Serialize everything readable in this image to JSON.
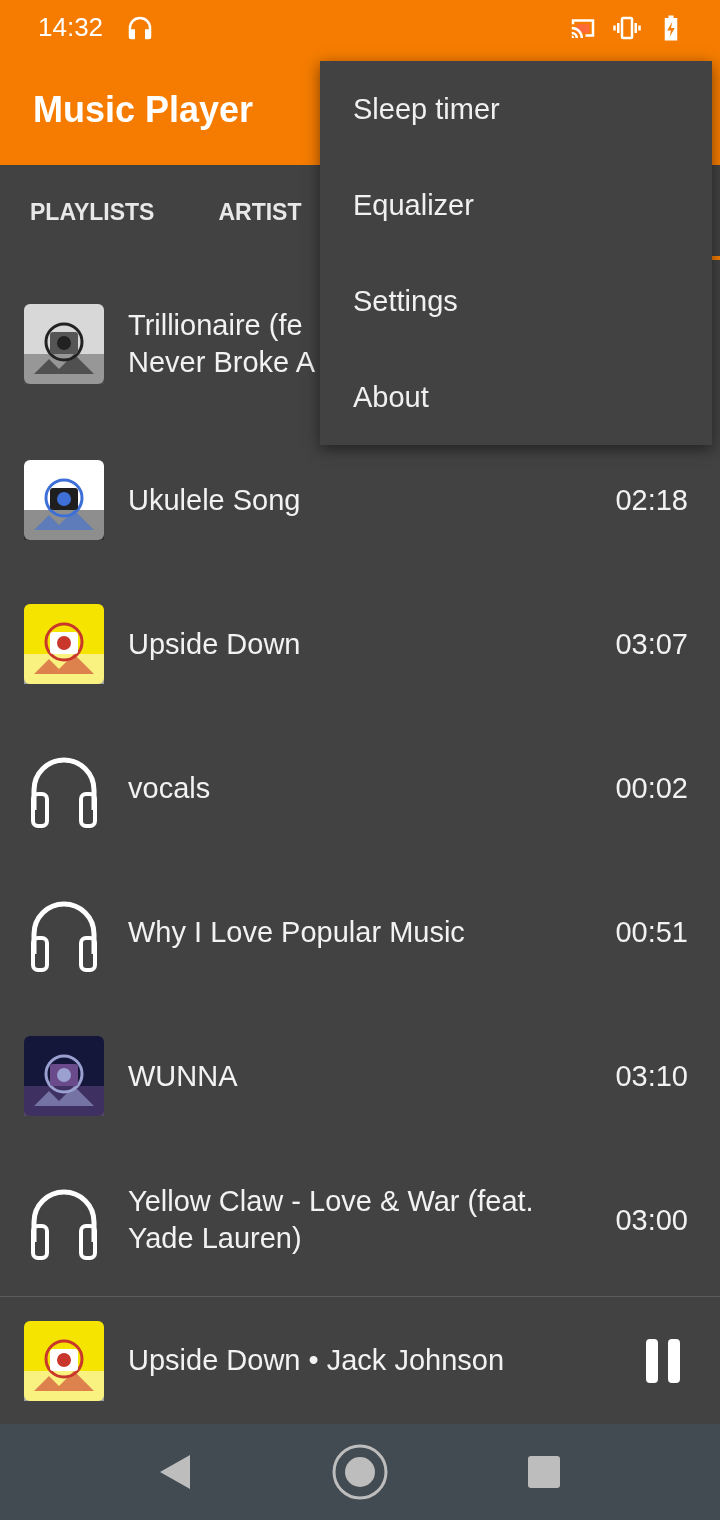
{
  "status_bar": {
    "time": "14:32"
  },
  "toolbar": {
    "title": "Music Player"
  },
  "tabs": [
    {
      "label": "PLAYLISTS",
      "selected": false
    },
    {
      "label": "ARTIST",
      "selected": false
    }
  ],
  "songs": [
    {
      "kind": "picture",
      "title": "Trillionaire (fe\nNever Broke A"
    },
    {
      "kind": "picture",
      "title": "Ukulele Song",
      "duration": "02:18"
    },
    {
      "kind": "picture",
      "title": "Upside Down",
      "duration": "03:07"
    },
    {
      "kind": "headphones",
      "title": "vocals",
      "duration": "00:02"
    },
    {
      "kind": "headphones",
      "title": "Why I Love Popular Music",
      "duration": "00:51"
    },
    {
      "kind": "picture",
      "title": "WUNNA",
      "duration": "03:10"
    },
    {
      "kind": "headphones",
      "title": "Yellow Claw - Love & War (feat. Yade Lauren)",
      "duration": "03:00"
    }
  ],
  "now_playing": {
    "kind": "picture",
    "text": "Upside Down • Jack Johnson",
    "playing": true
  },
  "menu": {
    "items": [
      "Sleep timer",
      "Equalizer",
      "Settings",
      "About"
    ]
  }
}
